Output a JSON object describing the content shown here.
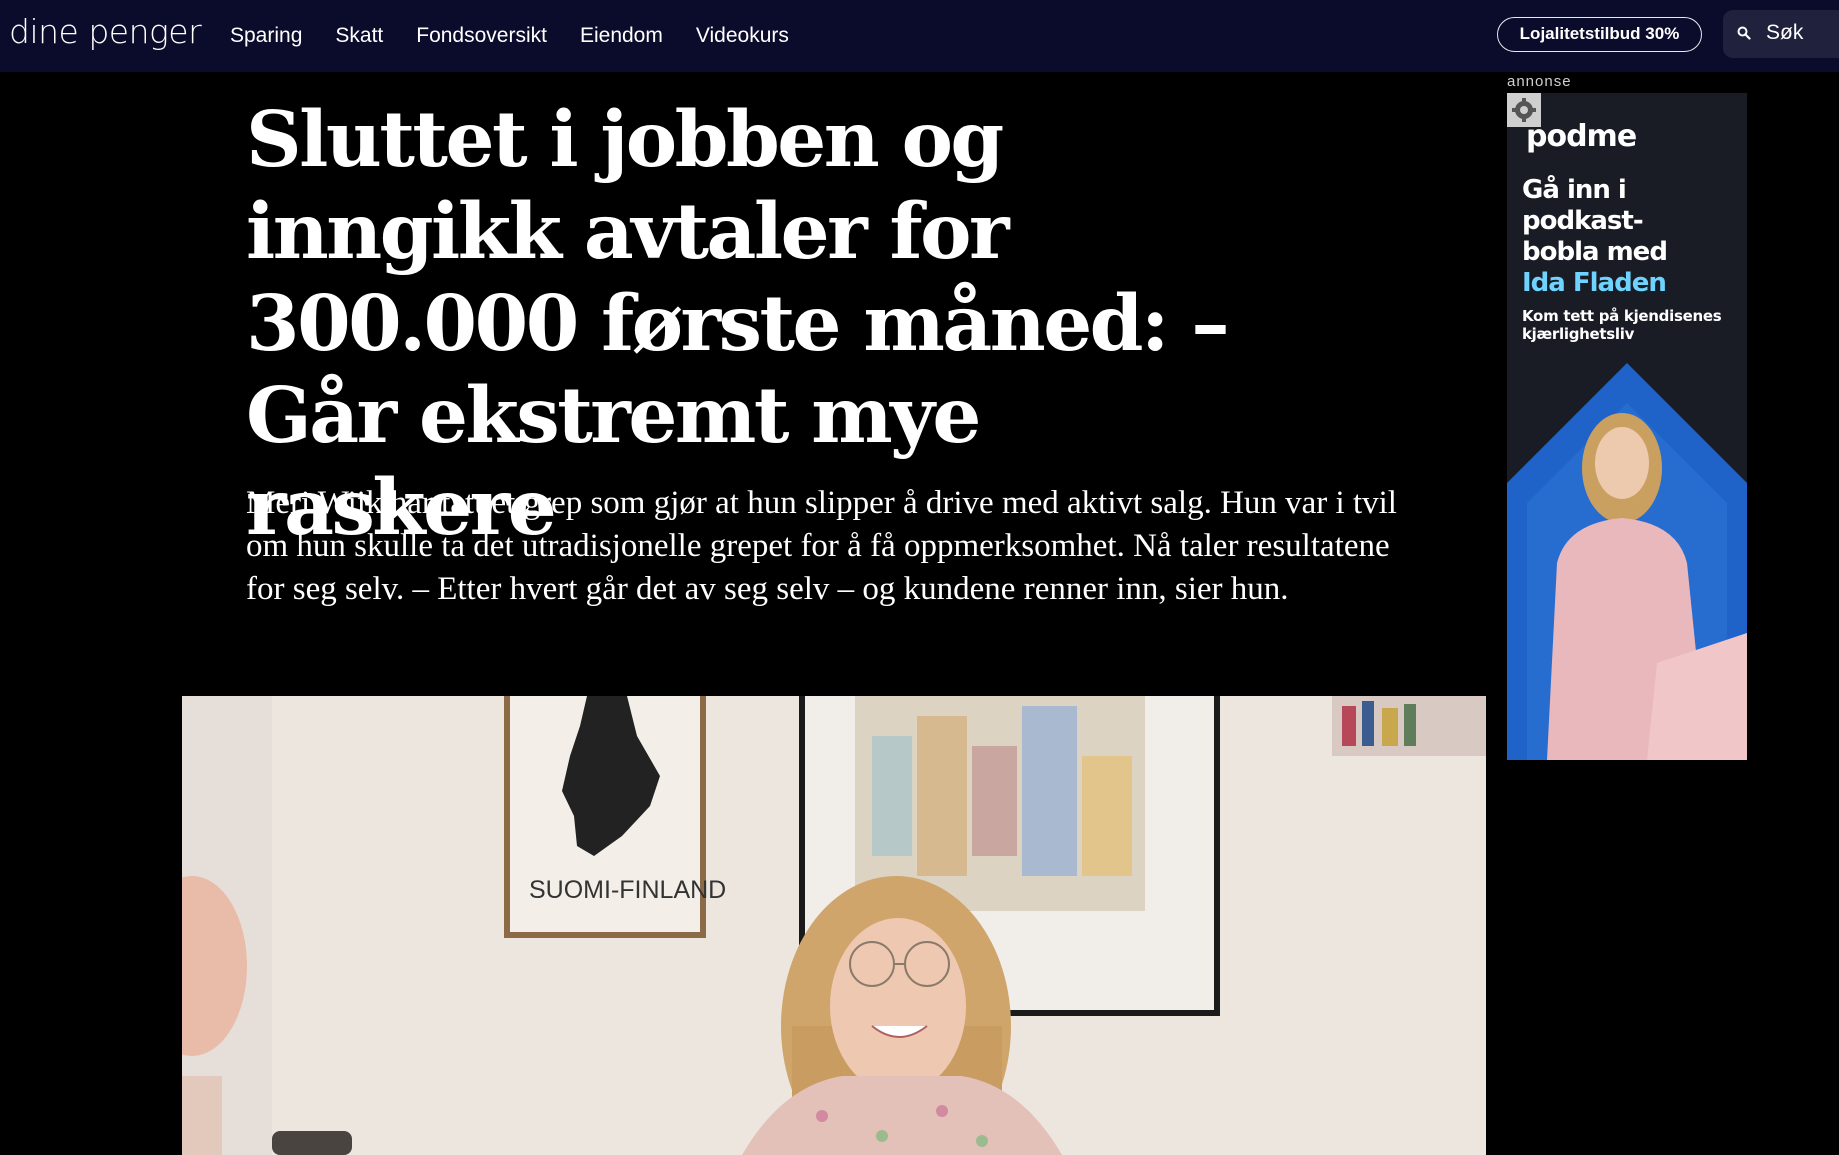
{
  "header": {
    "logo": "dine penger",
    "nav": [
      {
        "label": "Sparing"
      },
      {
        "label": "Skatt"
      },
      {
        "label": "Fondsoversikt"
      },
      {
        "label": "Eiendom"
      },
      {
        "label": "Videokurs"
      }
    ],
    "loyalty_button": "Lojalitetstilbud 30%",
    "search_label": "Søk"
  },
  "article": {
    "headline": "Sluttet i jobben og inngikk avtaler for 300.000 første måned: – Går ekstremt mye raskere",
    "lead": "Meri Wiik har tatt et grep som gjør at hun slipper å drive med aktivt salg. Hun var i tvil om hun skulle ta det utradisjonelle grepet for å få oppmerksomhet. Nå taler resultatene for seg selv. – Etter hvert går det av seg selv – og kundene renner inn, sier hun.",
    "hero_poster_text": "SUOMI-FINLAND"
  },
  "ad": {
    "label": "annonse",
    "brand": "podme",
    "headline_lines": [
      "Gå inn i",
      "podkast-",
      "bobla med"
    ],
    "headline_accent": "Ida Fladen",
    "subtext": "Kom tett på kjendisenes kjærlighetsliv"
  },
  "colors": {
    "nav_bg": "#0b0c2b",
    "page_bg": "#000000",
    "ad_accent": "#6fd3ff",
    "ad_blue": "#1f63c8"
  }
}
